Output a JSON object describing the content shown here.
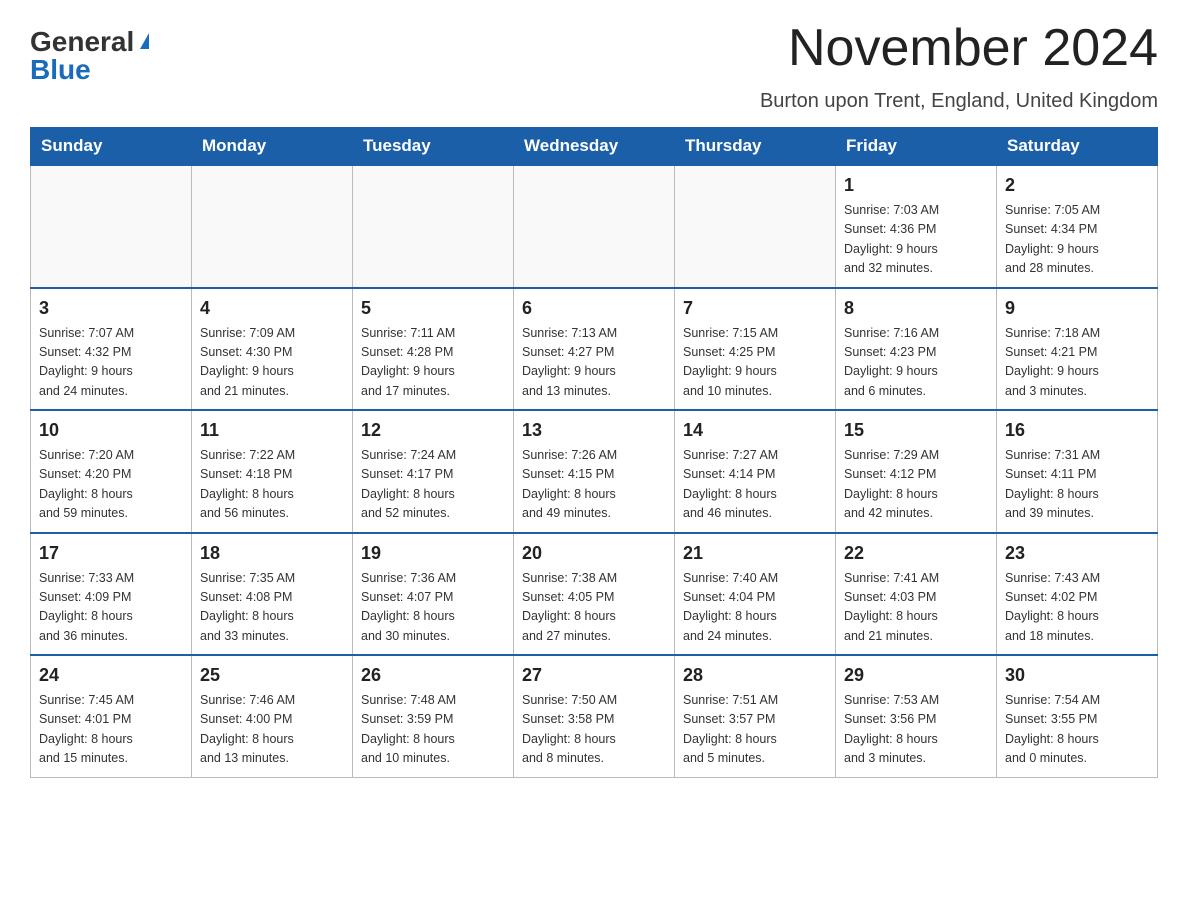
{
  "logo": {
    "general": "General",
    "blue": "Blue"
  },
  "header": {
    "month_year": "November 2024",
    "location": "Burton upon Trent, England, United Kingdom"
  },
  "weekdays": [
    "Sunday",
    "Monday",
    "Tuesday",
    "Wednesday",
    "Thursday",
    "Friday",
    "Saturday"
  ],
  "weeks": [
    [
      {
        "day": "",
        "info": ""
      },
      {
        "day": "",
        "info": ""
      },
      {
        "day": "",
        "info": ""
      },
      {
        "day": "",
        "info": ""
      },
      {
        "day": "",
        "info": ""
      },
      {
        "day": "1",
        "info": "Sunrise: 7:03 AM\nSunset: 4:36 PM\nDaylight: 9 hours\nand 32 minutes."
      },
      {
        "day": "2",
        "info": "Sunrise: 7:05 AM\nSunset: 4:34 PM\nDaylight: 9 hours\nand 28 minutes."
      }
    ],
    [
      {
        "day": "3",
        "info": "Sunrise: 7:07 AM\nSunset: 4:32 PM\nDaylight: 9 hours\nand 24 minutes."
      },
      {
        "day": "4",
        "info": "Sunrise: 7:09 AM\nSunset: 4:30 PM\nDaylight: 9 hours\nand 21 minutes."
      },
      {
        "day": "5",
        "info": "Sunrise: 7:11 AM\nSunset: 4:28 PM\nDaylight: 9 hours\nand 17 minutes."
      },
      {
        "day": "6",
        "info": "Sunrise: 7:13 AM\nSunset: 4:27 PM\nDaylight: 9 hours\nand 13 minutes."
      },
      {
        "day": "7",
        "info": "Sunrise: 7:15 AM\nSunset: 4:25 PM\nDaylight: 9 hours\nand 10 minutes."
      },
      {
        "day": "8",
        "info": "Sunrise: 7:16 AM\nSunset: 4:23 PM\nDaylight: 9 hours\nand 6 minutes."
      },
      {
        "day": "9",
        "info": "Sunrise: 7:18 AM\nSunset: 4:21 PM\nDaylight: 9 hours\nand 3 minutes."
      }
    ],
    [
      {
        "day": "10",
        "info": "Sunrise: 7:20 AM\nSunset: 4:20 PM\nDaylight: 8 hours\nand 59 minutes."
      },
      {
        "day": "11",
        "info": "Sunrise: 7:22 AM\nSunset: 4:18 PM\nDaylight: 8 hours\nand 56 minutes."
      },
      {
        "day": "12",
        "info": "Sunrise: 7:24 AM\nSunset: 4:17 PM\nDaylight: 8 hours\nand 52 minutes."
      },
      {
        "day": "13",
        "info": "Sunrise: 7:26 AM\nSunset: 4:15 PM\nDaylight: 8 hours\nand 49 minutes."
      },
      {
        "day": "14",
        "info": "Sunrise: 7:27 AM\nSunset: 4:14 PM\nDaylight: 8 hours\nand 46 minutes."
      },
      {
        "day": "15",
        "info": "Sunrise: 7:29 AM\nSunset: 4:12 PM\nDaylight: 8 hours\nand 42 minutes."
      },
      {
        "day": "16",
        "info": "Sunrise: 7:31 AM\nSunset: 4:11 PM\nDaylight: 8 hours\nand 39 minutes."
      }
    ],
    [
      {
        "day": "17",
        "info": "Sunrise: 7:33 AM\nSunset: 4:09 PM\nDaylight: 8 hours\nand 36 minutes."
      },
      {
        "day": "18",
        "info": "Sunrise: 7:35 AM\nSunset: 4:08 PM\nDaylight: 8 hours\nand 33 minutes."
      },
      {
        "day": "19",
        "info": "Sunrise: 7:36 AM\nSunset: 4:07 PM\nDaylight: 8 hours\nand 30 minutes."
      },
      {
        "day": "20",
        "info": "Sunrise: 7:38 AM\nSunset: 4:05 PM\nDaylight: 8 hours\nand 27 minutes."
      },
      {
        "day": "21",
        "info": "Sunrise: 7:40 AM\nSunset: 4:04 PM\nDaylight: 8 hours\nand 24 minutes."
      },
      {
        "day": "22",
        "info": "Sunrise: 7:41 AM\nSunset: 4:03 PM\nDaylight: 8 hours\nand 21 minutes."
      },
      {
        "day": "23",
        "info": "Sunrise: 7:43 AM\nSunset: 4:02 PM\nDaylight: 8 hours\nand 18 minutes."
      }
    ],
    [
      {
        "day": "24",
        "info": "Sunrise: 7:45 AM\nSunset: 4:01 PM\nDaylight: 8 hours\nand 15 minutes."
      },
      {
        "day": "25",
        "info": "Sunrise: 7:46 AM\nSunset: 4:00 PM\nDaylight: 8 hours\nand 13 minutes."
      },
      {
        "day": "26",
        "info": "Sunrise: 7:48 AM\nSunset: 3:59 PM\nDaylight: 8 hours\nand 10 minutes."
      },
      {
        "day": "27",
        "info": "Sunrise: 7:50 AM\nSunset: 3:58 PM\nDaylight: 8 hours\nand 8 minutes."
      },
      {
        "day": "28",
        "info": "Sunrise: 7:51 AM\nSunset: 3:57 PM\nDaylight: 8 hours\nand 5 minutes."
      },
      {
        "day": "29",
        "info": "Sunrise: 7:53 AM\nSunset: 3:56 PM\nDaylight: 8 hours\nand 3 minutes."
      },
      {
        "day": "30",
        "info": "Sunrise: 7:54 AM\nSunset: 3:55 PM\nDaylight: 8 hours\nand 0 minutes."
      }
    ]
  ]
}
